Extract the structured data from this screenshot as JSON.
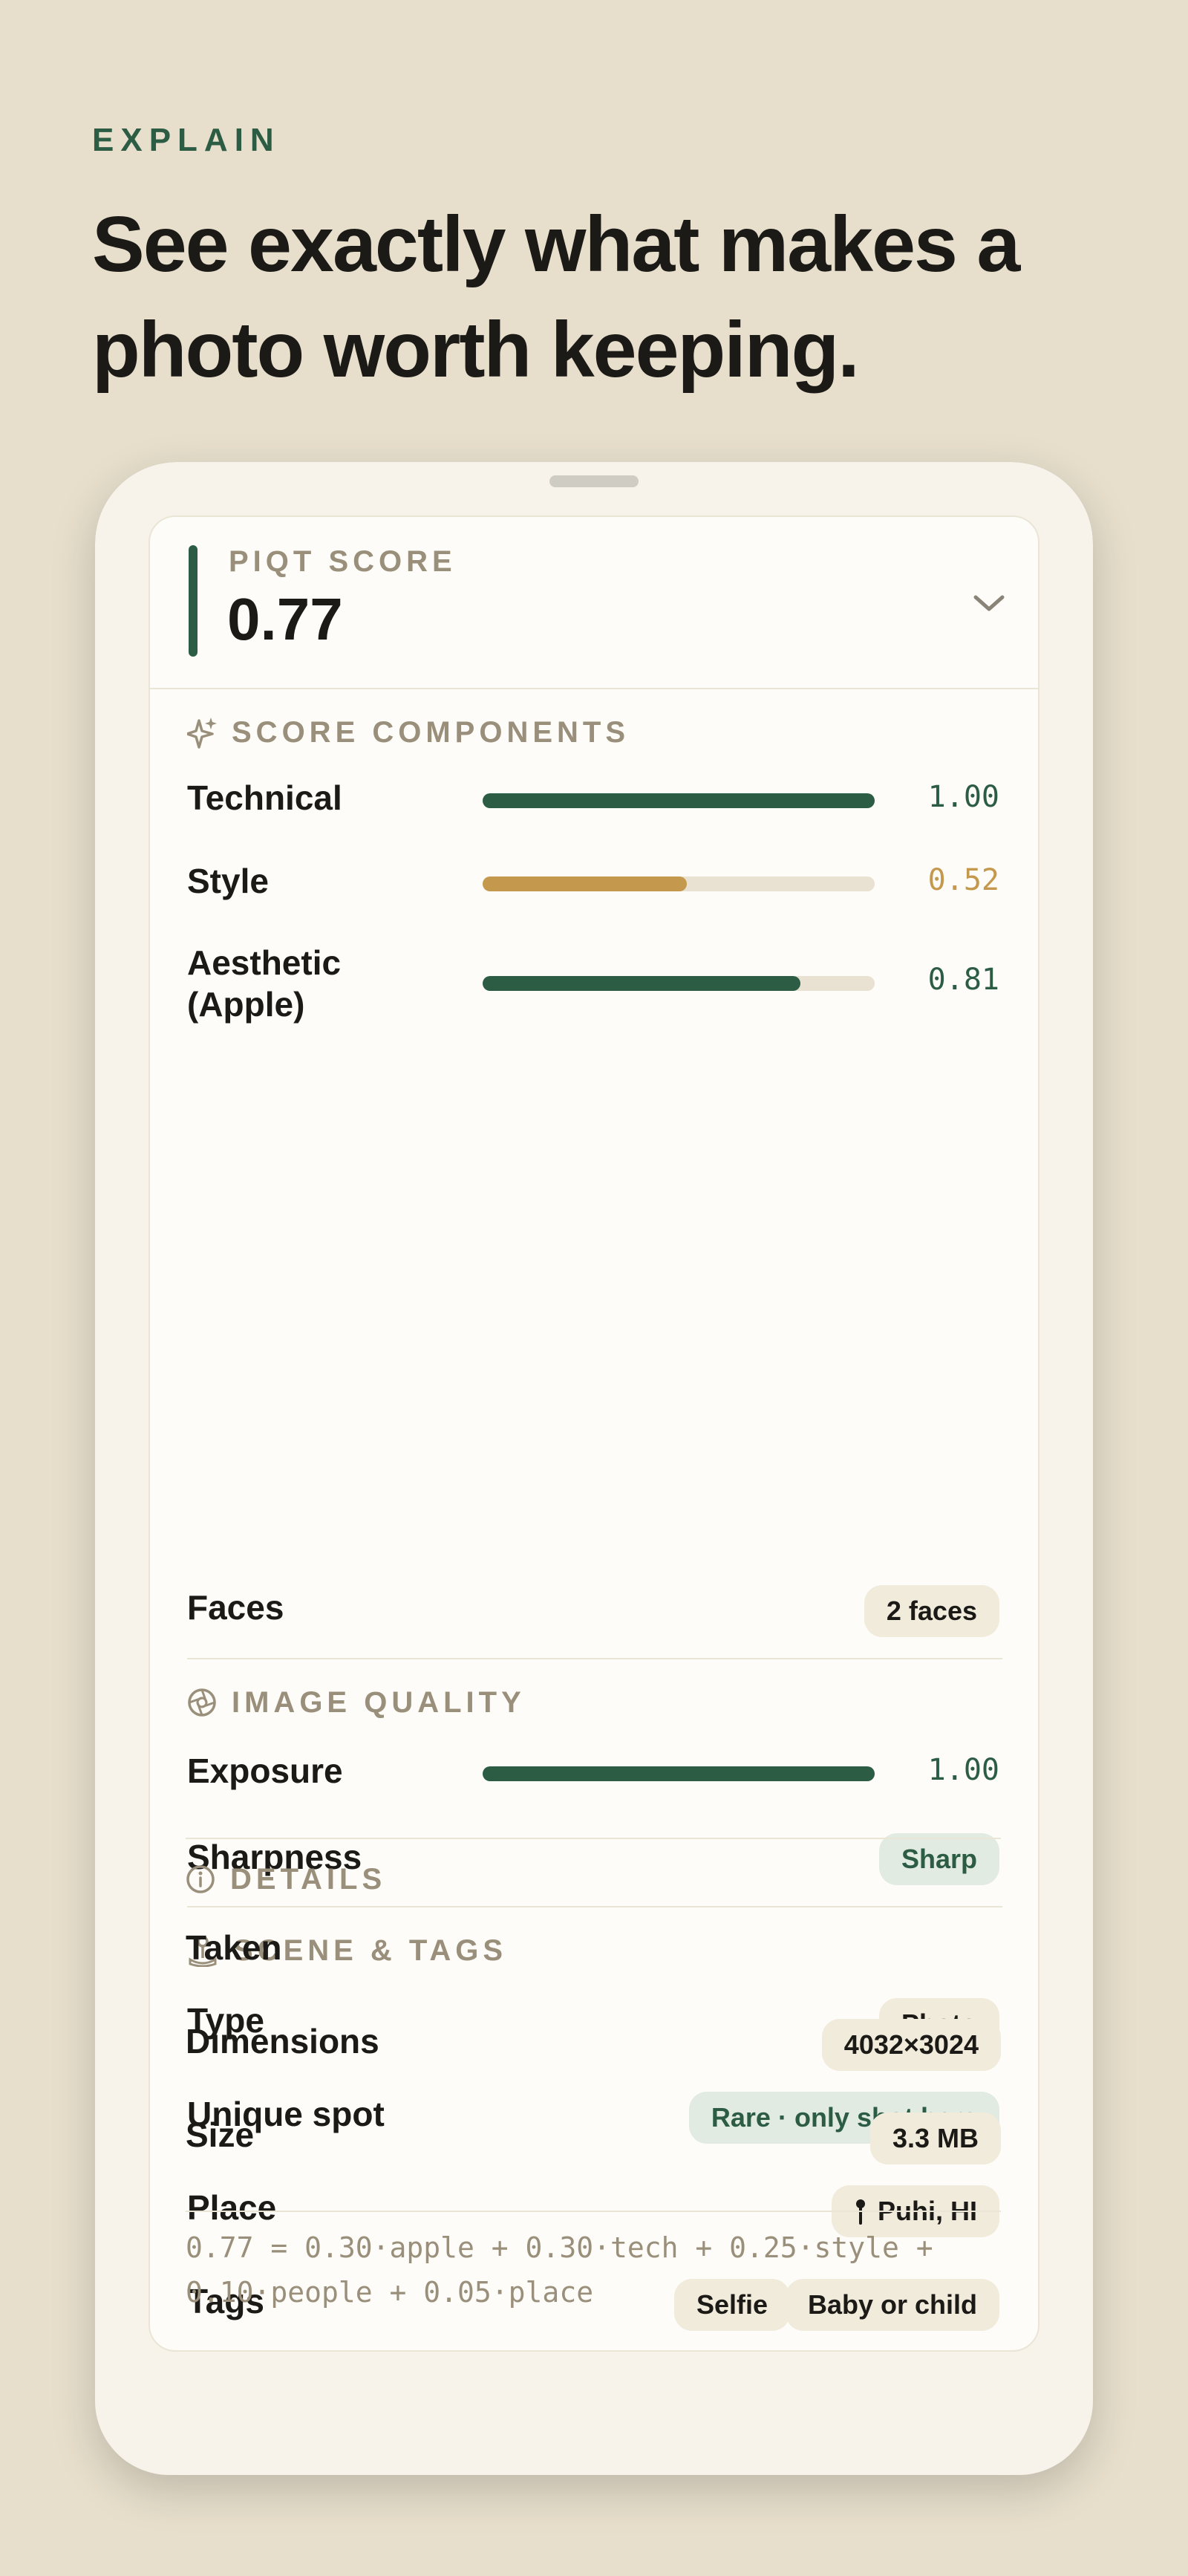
{
  "eyebrow": "EXPLAIN",
  "headline": "See exactly what makes a photo worth keeping.",
  "colors": {
    "background": "#e7dfcc",
    "accent_green": "#2c5d44",
    "accent_gold": "#c5994d",
    "muted_label": "#9a8f7a"
  },
  "score": {
    "label": "PIQT SCORE",
    "value": "0.77",
    "toggle_icon": "chevron-down-icon"
  },
  "score_components": {
    "title": "SCORE COMPONENTS",
    "icon": "sparkle-icon",
    "rows": [
      {
        "label": "Technical",
        "value": "1.00",
        "fraction": 1.0,
        "color": "#2c5d44"
      },
      {
        "label": "Style",
        "value": "0.52",
        "fraction": 0.52,
        "color": "#c5994d"
      },
      {
        "label": "Aesthetic\n(Apple)",
        "value": "0.81",
        "fraction": 0.81,
        "color": "#2c5d44"
      }
    ],
    "faces_label": "Faces",
    "faces_value": "2 faces"
  },
  "image_quality": {
    "title": "IMAGE QUALITY",
    "icon": "aperture-icon",
    "exposure_label": "Exposure",
    "exposure_value": "1.00",
    "exposure_fraction": 1.0,
    "sharpness_label": "Sharpness",
    "sharpness_value": "Sharp"
  },
  "scene_tags": {
    "title": "SCENE & TAGS",
    "icon": "map-pin-icon",
    "type_label": "Type",
    "type_value": "Photo",
    "unique_label": "Unique spot",
    "unique_value": "Rare · only shot here",
    "place_label": "Place",
    "place_value": "Puhi, HI",
    "tags_label": "Tags",
    "tags": [
      "Selfie",
      "Baby or child"
    ]
  },
  "details": {
    "title": "DETAILS",
    "icon": "info-icon",
    "taken_label": "Taken",
    "dimensions_label": "Dimensions",
    "dimensions_value": "4032×3024",
    "size_label": "Size",
    "size_value": "3.3 MB"
  },
  "formula": {
    "line1": "0.77 = 0.30·apple + 0.30·tech + 0.25·style +",
    "line2": "0.10·people + 0.05·place"
  }
}
